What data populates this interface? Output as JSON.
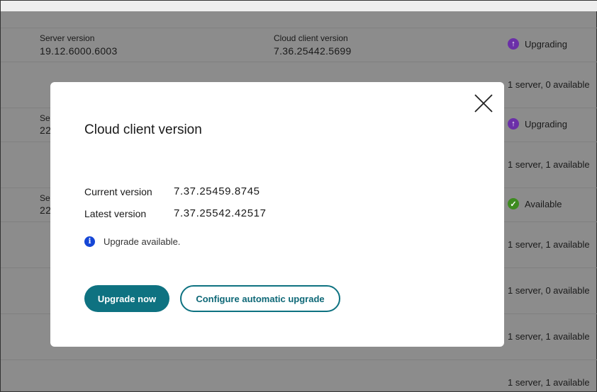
{
  "background": {
    "header_row": {
      "server_label": "Server version",
      "server_value": "19.12.6000.6003",
      "client_label": "Cloud client version",
      "client_value": "7.36.25442.5699",
      "status": "Upgrading"
    },
    "rows": [
      {
        "label_partial": "Se",
        "value_partial": "22",
        "status": "Upgrading",
        "status_type": "upgrading"
      },
      {
        "label_partial": "Se",
        "value_partial": "22",
        "status": "Available",
        "status_type": "available"
      }
    ],
    "counts": [
      "1 server, 0 available",
      "1 server, 1 available",
      "1 server, 1 available",
      "1 server, 0 available",
      "1 server, 1 available",
      "1 server, 1 available"
    ],
    "colors": {
      "upgrading": "#6b2fa8",
      "available": "#3d8b1f"
    }
  },
  "modal": {
    "title": "Cloud client version",
    "current_label": "Current version",
    "current_value": "7.37.25459.8745",
    "latest_label": "Latest version",
    "latest_value": "7.37.25542.42517",
    "info_text": "Upgrade available.",
    "upgrade_button": "Upgrade now",
    "configure_button": "Configure automatic upgrade",
    "accent": "#0e7281"
  }
}
